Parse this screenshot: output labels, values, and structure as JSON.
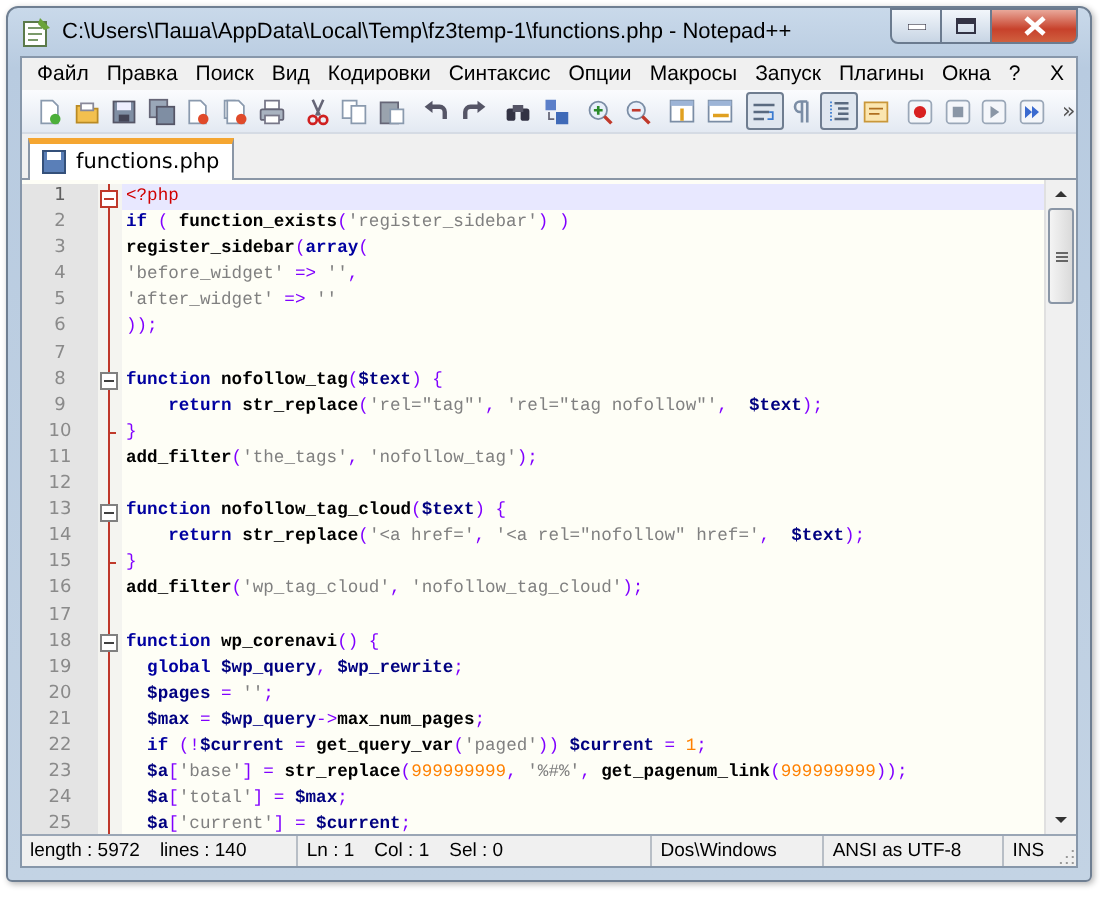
{
  "window": {
    "title": "C:\\Users\\Паша\\AppData\\Local\\Temp\\fz3temp-1\\functions.php - Notepad++"
  },
  "menu": [
    "Файл",
    "Правка",
    "Поиск",
    "Вид",
    "Кодировки",
    "Синтаксис",
    "Опции",
    "Макросы",
    "Запуск",
    "Плагины",
    "Окна",
    "?"
  ],
  "menu_close": "X",
  "toolbar": [
    [
      {
        "pressed": false
      },
      {
        "pressed": false
      },
      {
        "pressed": false
      },
      {
        "pressed": false
      },
      {
        "pressed": false
      },
      {
        "pressed": false
      },
      {
        "pressed": false
      }
    ],
    [
      {
        "pressed": false
      },
      {
        "pressed": false
      },
      {
        "pressed": false
      }
    ],
    [
      {
        "pressed": false
      },
      {
        "pressed": false
      }
    ],
    [
      {
        "pressed": false
      },
      {
        "pressed": false
      }
    ],
    [
      {
        "pressed": false
      },
      {
        "pressed": false
      }
    ],
    [
      {
        "pressed": false
      },
      {
        "pressed": false
      }
    ],
    [
      {
        "pressed": true
      },
      {
        "pressed": false
      },
      {
        "pressed": true
      },
      {
        "pressed": false
      }
    ],
    [
      {
        "pressed": false
      },
      {
        "pressed": false
      },
      {
        "pressed": false
      },
      {
        "pressed": false
      }
    ]
  ],
  "toolbar_overflow": "»",
  "tabs": [
    {
      "label": "functions.php",
      "selected": true
    }
  ],
  "editor": {
    "lines": [
      {
        "number": "1",
        "fold_start": true,
        "fold_end": false,
        "current": true,
        "tokens": [
          {
            "kind": "tag",
            "text": "<?php"
          }
        ]
      },
      {
        "number": "2",
        "fold_start": false,
        "fold_end": false,
        "current": false,
        "tokens": [
          {
            "kind": "keyword",
            "text": "if"
          },
          {
            "kind": "op",
            "text": " ( "
          },
          {
            "kind": "plain",
            "text": "function_exists"
          },
          {
            "kind": "op",
            "text": "("
          },
          {
            "kind": "string",
            "text": "'register_sidebar'"
          },
          {
            "kind": "op",
            "text": ") )"
          }
        ]
      },
      {
        "number": "3",
        "fold_start": false,
        "fold_end": false,
        "current": false,
        "tokens": [
          {
            "kind": "plain",
            "text": "register_sidebar"
          },
          {
            "kind": "op",
            "text": "("
          },
          {
            "kind": "keyword",
            "text": "array"
          },
          {
            "kind": "op",
            "text": "("
          }
        ]
      },
      {
        "number": "4",
        "fold_start": false,
        "fold_end": false,
        "current": false,
        "tokens": [
          {
            "kind": "string",
            "text": "'before_widget'"
          },
          {
            "kind": "op",
            "text": " => "
          },
          {
            "kind": "string",
            "text": "''"
          },
          {
            "kind": "op",
            "text": ","
          }
        ]
      },
      {
        "number": "5",
        "fold_start": false,
        "fold_end": false,
        "current": false,
        "tokens": [
          {
            "kind": "string",
            "text": "'after_widget'"
          },
          {
            "kind": "op",
            "text": " => "
          },
          {
            "kind": "string",
            "text": "''"
          }
        ]
      },
      {
        "number": "6",
        "fold_start": false,
        "fold_end": false,
        "current": false,
        "tokens": [
          {
            "kind": "op",
            "text": "));"
          }
        ]
      },
      {
        "number": "7",
        "fold_start": false,
        "fold_end": false,
        "current": false
      },
      {
        "number": "8",
        "fold_start": true,
        "fold_end": false,
        "current": false,
        "tokens": [
          {
            "kind": "keyword",
            "text": "function"
          },
          {
            "kind": "plain",
            "text": " nofollow_tag"
          },
          {
            "kind": "op",
            "text": "("
          },
          {
            "kind": "var",
            "text": "$text"
          },
          {
            "kind": "op",
            "text": ") {"
          }
        ]
      },
      {
        "number": "9",
        "fold_start": false,
        "fold_end": false,
        "current": false,
        "tokens": [
          {
            "kind": "keyword",
            "text": "    return"
          },
          {
            "kind": "plain",
            "text": " str_replace"
          },
          {
            "kind": "op",
            "text": "("
          },
          {
            "kind": "string",
            "text": "'rel=\"tag\"'"
          },
          {
            "kind": "op",
            "text": ", "
          },
          {
            "kind": "string",
            "text": "'rel=\"tag nofollow\"'"
          },
          {
            "kind": "op",
            "text": ",  "
          },
          {
            "kind": "var",
            "text": "$text"
          },
          {
            "kind": "op",
            "text": ");"
          }
        ]
      },
      {
        "number": "10",
        "fold_start": false,
        "fold_end": true,
        "current": false,
        "tokens": [
          {
            "kind": "op",
            "text": "}"
          }
        ]
      },
      {
        "number": "11",
        "fold_start": false,
        "fold_end": false,
        "current": false,
        "tokens": [
          {
            "kind": "plain",
            "text": "add_filter"
          },
          {
            "kind": "op",
            "text": "("
          },
          {
            "kind": "string",
            "text": "'the_tags'"
          },
          {
            "kind": "op",
            "text": ", "
          },
          {
            "kind": "string",
            "text": "'nofollow_tag'"
          },
          {
            "kind": "op",
            "text": ");"
          }
        ]
      },
      {
        "number": "12",
        "fold_start": false,
        "fold_end": false,
        "current": false
      },
      {
        "number": "13",
        "fold_start": true,
        "fold_end": false,
        "current": false,
        "tokens": [
          {
            "kind": "keyword",
            "text": "function"
          },
          {
            "kind": "plain",
            "text": " nofollow_tag_cloud"
          },
          {
            "kind": "op",
            "text": "("
          },
          {
            "kind": "var",
            "text": "$text"
          },
          {
            "kind": "op",
            "text": ") {"
          }
        ]
      },
      {
        "number": "14",
        "fold_start": false,
        "fold_end": false,
        "current": false,
        "tokens": [
          {
            "kind": "keyword",
            "text": "    return"
          },
          {
            "kind": "plain",
            "text": " str_replace"
          },
          {
            "kind": "op",
            "text": "("
          },
          {
            "kind": "string",
            "text": "'<a href='"
          },
          {
            "kind": "op",
            "text": ", "
          },
          {
            "kind": "string",
            "text": "'<a rel=\"nofollow\" href='"
          },
          {
            "kind": "op",
            "text": ",  "
          },
          {
            "kind": "var",
            "text": "$text"
          },
          {
            "kind": "op",
            "text": ");"
          }
        ]
      },
      {
        "number": "15",
        "fold_start": false,
        "fold_end": true,
        "current": false,
        "tokens": [
          {
            "kind": "op",
            "text": "}"
          }
        ]
      },
      {
        "number": "16",
        "fold_start": false,
        "fold_end": false,
        "current": false,
        "tokens": [
          {
            "kind": "plain",
            "text": "add_filter"
          },
          {
            "kind": "op",
            "text": "("
          },
          {
            "kind": "string",
            "text": "'wp_tag_cloud'"
          },
          {
            "kind": "op",
            "text": ", "
          },
          {
            "kind": "string",
            "text": "'nofollow_tag_cloud'"
          },
          {
            "kind": "op",
            "text": ");"
          }
        ]
      },
      {
        "number": "17",
        "fold_start": false,
        "fold_end": false,
        "current": false
      },
      {
        "number": "18",
        "fold_start": true,
        "fold_end": false,
        "current": false,
        "tokens": [
          {
            "kind": "keyword",
            "text": "function"
          },
          {
            "kind": "plain",
            "text": " wp_corenavi"
          },
          {
            "kind": "op",
            "text": "() {"
          }
        ]
      },
      {
        "number": "19",
        "fold_start": false,
        "fold_end": false,
        "current": false,
        "tokens": [
          {
            "kind": "keyword",
            "text": "  global "
          },
          {
            "kind": "var",
            "text": "$wp_query"
          },
          {
            "kind": "op",
            "text": ", "
          },
          {
            "kind": "var",
            "text": "$wp_rewrite"
          },
          {
            "kind": "op",
            "text": ";"
          }
        ]
      },
      {
        "number": "20",
        "fold_start": false,
        "fold_end": false,
        "current": false,
        "tokens": [
          {
            "kind": "var",
            "text": "  $pages"
          },
          {
            "kind": "op",
            "text": " = "
          },
          {
            "kind": "string",
            "text": "''"
          },
          {
            "kind": "op",
            "text": ";"
          }
        ]
      },
      {
        "number": "21",
        "fold_start": false,
        "fold_end": false,
        "current": false,
        "tokens": [
          {
            "kind": "var",
            "text": "  $max"
          },
          {
            "kind": "op",
            "text": " = "
          },
          {
            "kind": "var",
            "text": "$wp_query"
          },
          {
            "kind": "op",
            "text": "->"
          },
          {
            "kind": "plain",
            "text": "max_num_pages"
          },
          {
            "kind": "op",
            "text": ";"
          }
        ]
      },
      {
        "number": "22",
        "fold_start": false,
        "fold_end": false,
        "current": false,
        "tokens": [
          {
            "kind": "keyword",
            "text": "  if"
          },
          {
            "kind": "op",
            "text": " (!"
          },
          {
            "kind": "var",
            "text": "$current"
          },
          {
            "kind": "op",
            "text": " = "
          },
          {
            "kind": "plain",
            "text": "get_query_var"
          },
          {
            "kind": "op",
            "text": "("
          },
          {
            "kind": "string",
            "text": "'paged'"
          },
          {
            "kind": "op",
            "text": ")) "
          },
          {
            "kind": "var",
            "text": "$current"
          },
          {
            "kind": "op",
            "text": " = "
          },
          {
            "kind": "number",
            "text": "1"
          },
          {
            "kind": "op",
            "text": ";"
          }
        ]
      },
      {
        "number": "23",
        "fold_start": false,
        "fold_end": false,
        "current": false,
        "tokens": [
          {
            "kind": "var",
            "text": "  $a"
          },
          {
            "kind": "op",
            "text": "["
          },
          {
            "kind": "string",
            "text": "'base'"
          },
          {
            "kind": "op",
            "text": "] = "
          },
          {
            "kind": "plain",
            "text": "str_replace"
          },
          {
            "kind": "op",
            "text": "("
          },
          {
            "kind": "number",
            "text": "999999999"
          },
          {
            "kind": "op",
            "text": ", "
          },
          {
            "kind": "string",
            "text": "'%#%'"
          },
          {
            "kind": "op",
            "text": ", "
          },
          {
            "kind": "plain",
            "text": "get_pagenum_link"
          },
          {
            "kind": "op",
            "text": "("
          },
          {
            "kind": "number",
            "text": "999999999"
          },
          {
            "kind": "op",
            "text": "));"
          }
        ]
      },
      {
        "number": "24",
        "fold_start": false,
        "fold_end": false,
        "current": false,
        "tokens": [
          {
            "kind": "var",
            "text": "  $a"
          },
          {
            "kind": "op",
            "text": "["
          },
          {
            "kind": "string",
            "text": "'total'"
          },
          {
            "kind": "op",
            "text": "] = "
          },
          {
            "kind": "var",
            "text": "$max"
          },
          {
            "kind": "op",
            "text": ";"
          }
        ]
      },
      {
        "number": "25",
        "fold_start": false,
        "fold_end": false,
        "current": false,
        "tokens": [
          {
            "kind": "var",
            "text": "  $a"
          },
          {
            "kind": "op",
            "text": "["
          },
          {
            "kind": "string",
            "text": "'current'"
          },
          {
            "kind": "op",
            "text": "] = "
          },
          {
            "kind": "var",
            "text": "$current"
          },
          {
            "kind": "op",
            "text": ";"
          }
        ]
      }
    ]
  },
  "status_bar": [
    [
      "length : 5972",
      "lines : 140"
    ],
    [
      "Ln : 1",
      "Col : 1",
      "Sel : 0"
    ],
    [
      "Dos\\Windows"
    ],
    [
      "ANSI as UTF-8"
    ],
    [
      "INS"
    ]
  ]
}
